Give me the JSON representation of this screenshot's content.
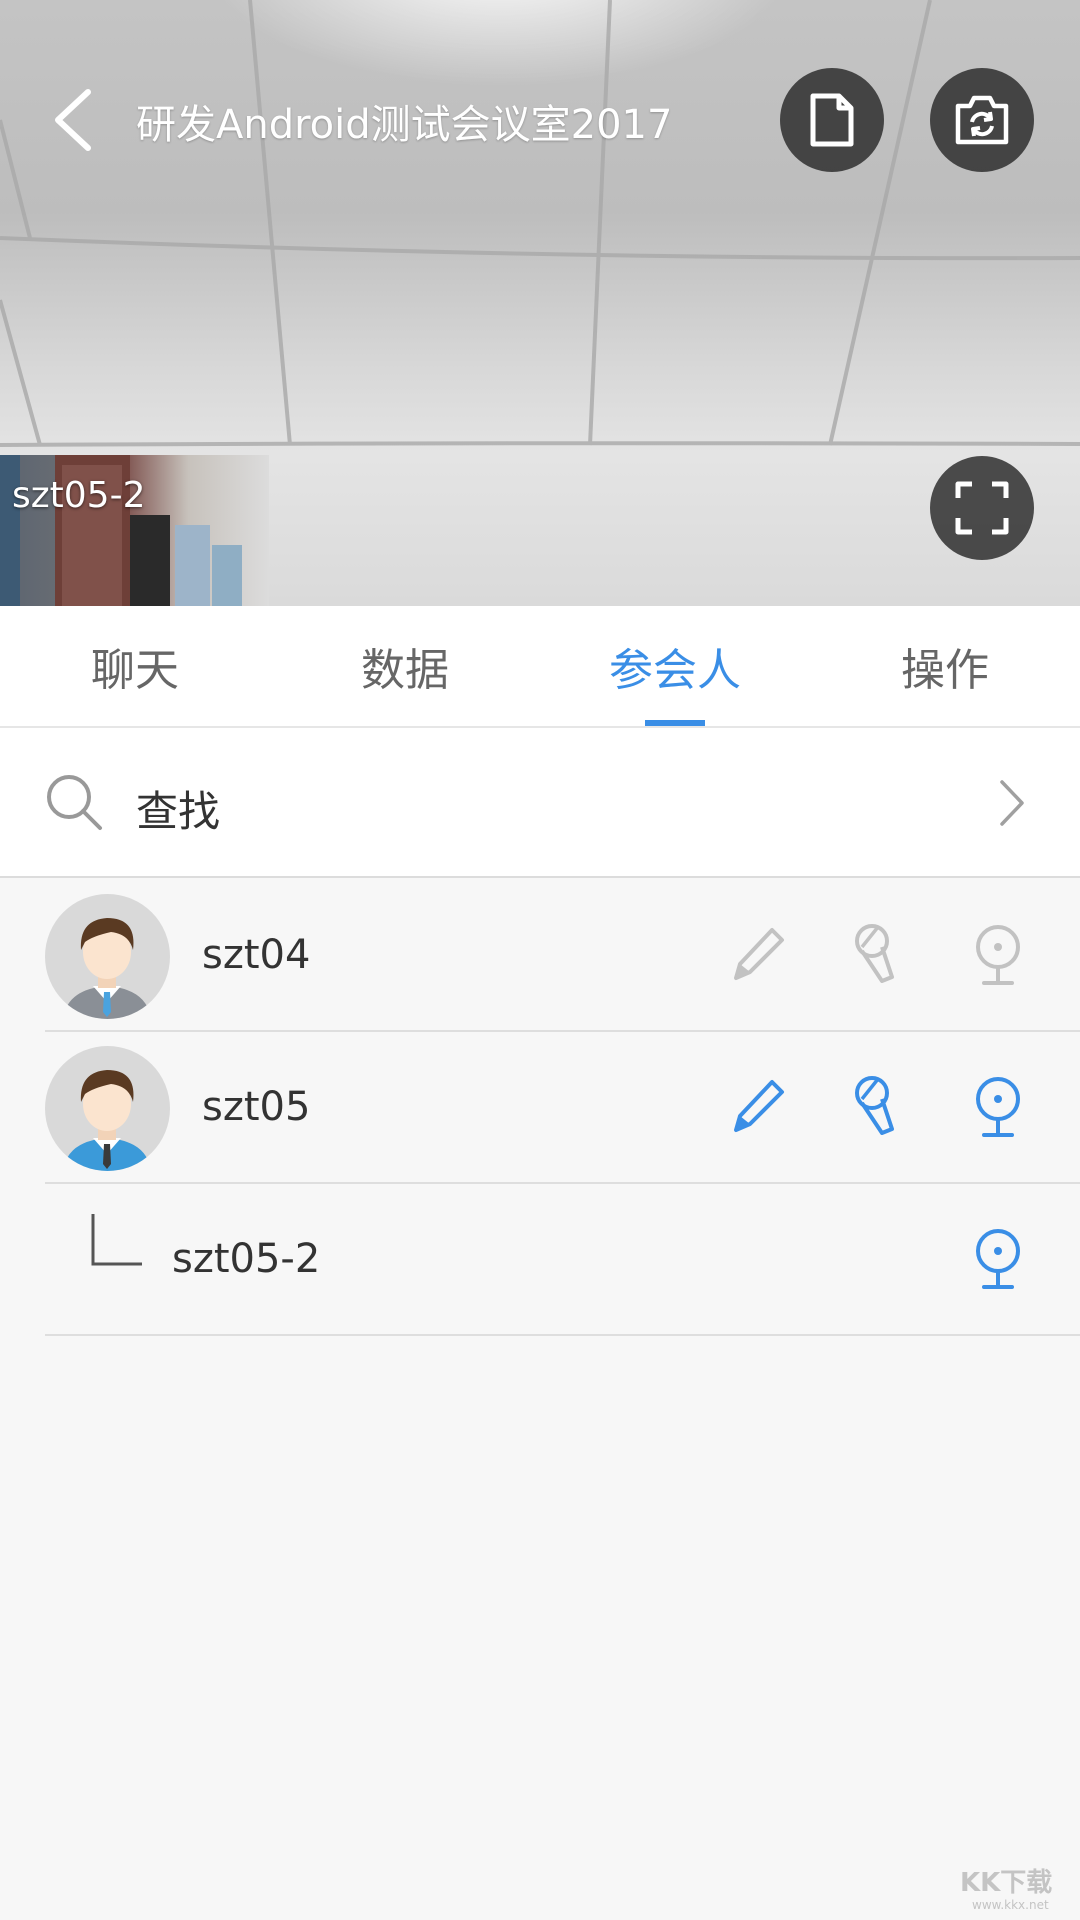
{
  "header": {
    "title": "研发Android测试会议室2017"
  },
  "thumbnail": {
    "label": "szt05-2"
  },
  "tabs": [
    {
      "label": "聊天",
      "active": false
    },
    {
      "label": "数据",
      "active": false
    },
    {
      "label": "参会人",
      "active": true
    },
    {
      "label": "操作",
      "active": false
    }
  ],
  "search": {
    "label": "查找"
  },
  "participants": [
    {
      "name": "szt04",
      "pen": "inactive",
      "mic": "inactive",
      "camera": "inactive"
    },
    {
      "name": "szt05",
      "pen": "active",
      "mic": "active",
      "camera": "active"
    }
  ],
  "sub_devices": [
    {
      "name": "szt05-2",
      "camera": "active"
    }
  ],
  "colors": {
    "accent": "#3a8ee6",
    "inactive_icon": "#c2c2c2"
  },
  "watermark": {
    "brand": "KK下载",
    "url": "www.kkx.net"
  }
}
